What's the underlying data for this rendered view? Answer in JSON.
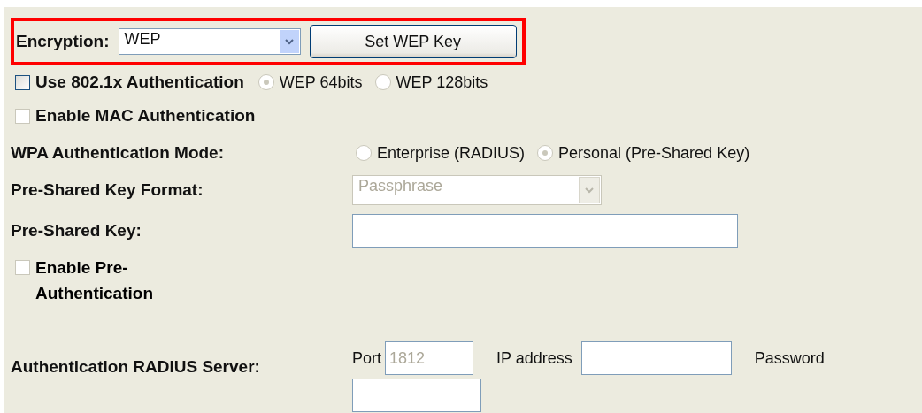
{
  "encryption": {
    "label": "Encryption:",
    "value": "WEP",
    "button": "Set WEP Key",
    "highlighted": true
  },
  "use_8021x": {
    "label": "Use 802.1x Authentication",
    "checked": false,
    "disabled": false
  },
  "wep_key_length": {
    "disabled": true,
    "options": [
      {
        "label": "WEP 64bits",
        "selected": true
      },
      {
        "label": "WEP 128bits",
        "selected": false
      }
    ]
  },
  "mac_auth": {
    "label": "Enable MAC Authentication",
    "checked": false,
    "disabled": true
  },
  "wpa_mode": {
    "label": "WPA Authentication Mode:",
    "disabled": true,
    "options": [
      {
        "label": "Enterprise (RADIUS)",
        "selected": false
      },
      {
        "label": "Personal (Pre-Shared Key)",
        "selected": true
      }
    ]
  },
  "psk_format": {
    "label": "Pre-Shared Key Format:",
    "value": "Passphrase",
    "disabled": true
  },
  "psk": {
    "label": "Pre-Shared Key:"
  },
  "pre_auth": {
    "label": "Enable Pre-Authentication",
    "checked": false,
    "disabled": true
  },
  "radius": {
    "label": "Authentication RADIUS Server:",
    "port_label": "Port",
    "port": "1812",
    "port_disabled": true,
    "ip_label": "IP address",
    "password_label": "Password"
  }
}
